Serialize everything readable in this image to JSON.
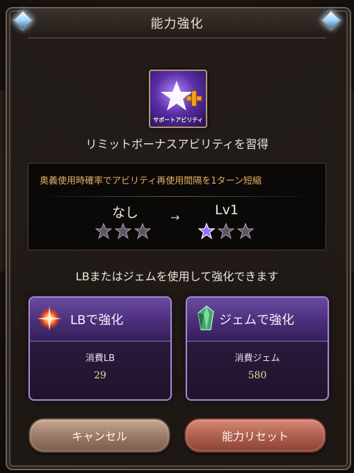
{
  "dialog": {
    "title": "能力強化"
  },
  "ability": {
    "icon": "star-plus-icon",
    "icon_caption": "サポートアビリティ",
    "heading": "リミットボーナスアビリティを習得",
    "effect": "奥義使用時確率でアビリティ再使用間隔を1ターン短縮",
    "level_before": "なし",
    "level_after": "Lv1",
    "stars_before_filled": 0,
    "stars_after_filled": 1,
    "stars_total": 3
  },
  "note": "LBまたはジェムを使用して強化できます",
  "options": {
    "lb": {
      "title": "LBで強化",
      "cost_label": "消費LB",
      "cost_value": "29",
      "icon": "sparkle-orb-icon"
    },
    "gem": {
      "title": "ジェムで強化",
      "cost_label": "消費ジェム",
      "cost_value": "580",
      "icon": "gem-crystal-icon"
    }
  },
  "buttons": {
    "cancel": "キャンセル",
    "reset": "能力リセット"
  },
  "colors": {
    "effect_text": "#e9b065",
    "card_border": "#a48ac9",
    "cost_value": "#f3d98a"
  }
}
